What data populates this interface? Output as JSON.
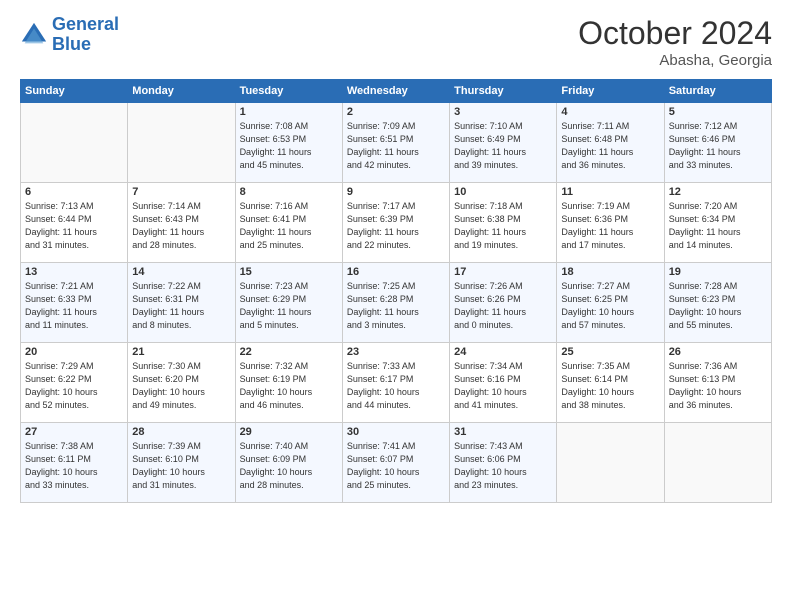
{
  "header": {
    "logo_line1": "General",
    "logo_line2": "Blue",
    "month": "October 2024",
    "location": "Abasha, Georgia"
  },
  "days_of_week": [
    "Sunday",
    "Monday",
    "Tuesday",
    "Wednesday",
    "Thursday",
    "Friday",
    "Saturday"
  ],
  "weeks": [
    [
      {
        "num": "",
        "info": ""
      },
      {
        "num": "",
        "info": ""
      },
      {
        "num": "1",
        "info": "Sunrise: 7:08 AM\nSunset: 6:53 PM\nDaylight: 11 hours\nand 45 minutes."
      },
      {
        "num": "2",
        "info": "Sunrise: 7:09 AM\nSunset: 6:51 PM\nDaylight: 11 hours\nand 42 minutes."
      },
      {
        "num": "3",
        "info": "Sunrise: 7:10 AM\nSunset: 6:49 PM\nDaylight: 11 hours\nand 39 minutes."
      },
      {
        "num": "4",
        "info": "Sunrise: 7:11 AM\nSunset: 6:48 PM\nDaylight: 11 hours\nand 36 minutes."
      },
      {
        "num": "5",
        "info": "Sunrise: 7:12 AM\nSunset: 6:46 PM\nDaylight: 11 hours\nand 33 minutes."
      }
    ],
    [
      {
        "num": "6",
        "info": "Sunrise: 7:13 AM\nSunset: 6:44 PM\nDaylight: 11 hours\nand 31 minutes."
      },
      {
        "num": "7",
        "info": "Sunrise: 7:14 AM\nSunset: 6:43 PM\nDaylight: 11 hours\nand 28 minutes."
      },
      {
        "num": "8",
        "info": "Sunrise: 7:16 AM\nSunset: 6:41 PM\nDaylight: 11 hours\nand 25 minutes."
      },
      {
        "num": "9",
        "info": "Sunrise: 7:17 AM\nSunset: 6:39 PM\nDaylight: 11 hours\nand 22 minutes."
      },
      {
        "num": "10",
        "info": "Sunrise: 7:18 AM\nSunset: 6:38 PM\nDaylight: 11 hours\nand 19 minutes."
      },
      {
        "num": "11",
        "info": "Sunrise: 7:19 AM\nSunset: 6:36 PM\nDaylight: 11 hours\nand 17 minutes."
      },
      {
        "num": "12",
        "info": "Sunrise: 7:20 AM\nSunset: 6:34 PM\nDaylight: 11 hours\nand 14 minutes."
      }
    ],
    [
      {
        "num": "13",
        "info": "Sunrise: 7:21 AM\nSunset: 6:33 PM\nDaylight: 11 hours\nand 11 minutes."
      },
      {
        "num": "14",
        "info": "Sunrise: 7:22 AM\nSunset: 6:31 PM\nDaylight: 11 hours\nand 8 minutes."
      },
      {
        "num": "15",
        "info": "Sunrise: 7:23 AM\nSunset: 6:29 PM\nDaylight: 11 hours\nand 5 minutes."
      },
      {
        "num": "16",
        "info": "Sunrise: 7:25 AM\nSunset: 6:28 PM\nDaylight: 11 hours\nand 3 minutes."
      },
      {
        "num": "17",
        "info": "Sunrise: 7:26 AM\nSunset: 6:26 PM\nDaylight: 11 hours\nand 0 minutes."
      },
      {
        "num": "18",
        "info": "Sunrise: 7:27 AM\nSunset: 6:25 PM\nDaylight: 10 hours\nand 57 minutes."
      },
      {
        "num": "19",
        "info": "Sunrise: 7:28 AM\nSunset: 6:23 PM\nDaylight: 10 hours\nand 55 minutes."
      }
    ],
    [
      {
        "num": "20",
        "info": "Sunrise: 7:29 AM\nSunset: 6:22 PM\nDaylight: 10 hours\nand 52 minutes."
      },
      {
        "num": "21",
        "info": "Sunrise: 7:30 AM\nSunset: 6:20 PM\nDaylight: 10 hours\nand 49 minutes."
      },
      {
        "num": "22",
        "info": "Sunrise: 7:32 AM\nSunset: 6:19 PM\nDaylight: 10 hours\nand 46 minutes."
      },
      {
        "num": "23",
        "info": "Sunrise: 7:33 AM\nSunset: 6:17 PM\nDaylight: 10 hours\nand 44 minutes."
      },
      {
        "num": "24",
        "info": "Sunrise: 7:34 AM\nSunset: 6:16 PM\nDaylight: 10 hours\nand 41 minutes."
      },
      {
        "num": "25",
        "info": "Sunrise: 7:35 AM\nSunset: 6:14 PM\nDaylight: 10 hours\nand 38 minutes."
      },
      {
        "num": "26",
        "info": "Sunrise: 7:36 AM\nSunset: 6:13 PM\nDaylight: 10 hours\nand 36 minutes."
      }
    ],
    [
      {
        "num": "27",
        "info": "Sunrise: 7:38 AM\nSunset: 6:11 PM\nDaylight: 10 hours\nand 33 minutes."
      },
      {
        "num": "28",
        "info": "Sunrise: 7:39 AM\nSunset: 6:10 PM\nDaylight: 10 hours\nand 31 minutes."
      },
      {
        "num": "29",
        "info": "Sunrise: 7:40 AM\nSunset: 6:09 PM\nDaylight: 10 hours\nand 28 minutes."
      },
      {
        "num": "30",
        "info": "Sunrise: 7:41 AM\nSunset: 6:07 PM\nDaylight: 10 hours\nand 25 minutes."
      },
      {
        "num": "31",
        "info": "Sunrise: 7:43 AM\nSunset: 6:06 PM\nDaylight: 10 hours\nand 23 minutes."
      },
      {
        "num": "",
        "info": ""
      },
      {
        "num": "",
        "info": ""
      }
    ]
  ],
  "colors": {
    "header_bg": "#2a6db5",
    "row_odd": "#eef3fb",
    "row_even": "#ffffff"
  }
}
